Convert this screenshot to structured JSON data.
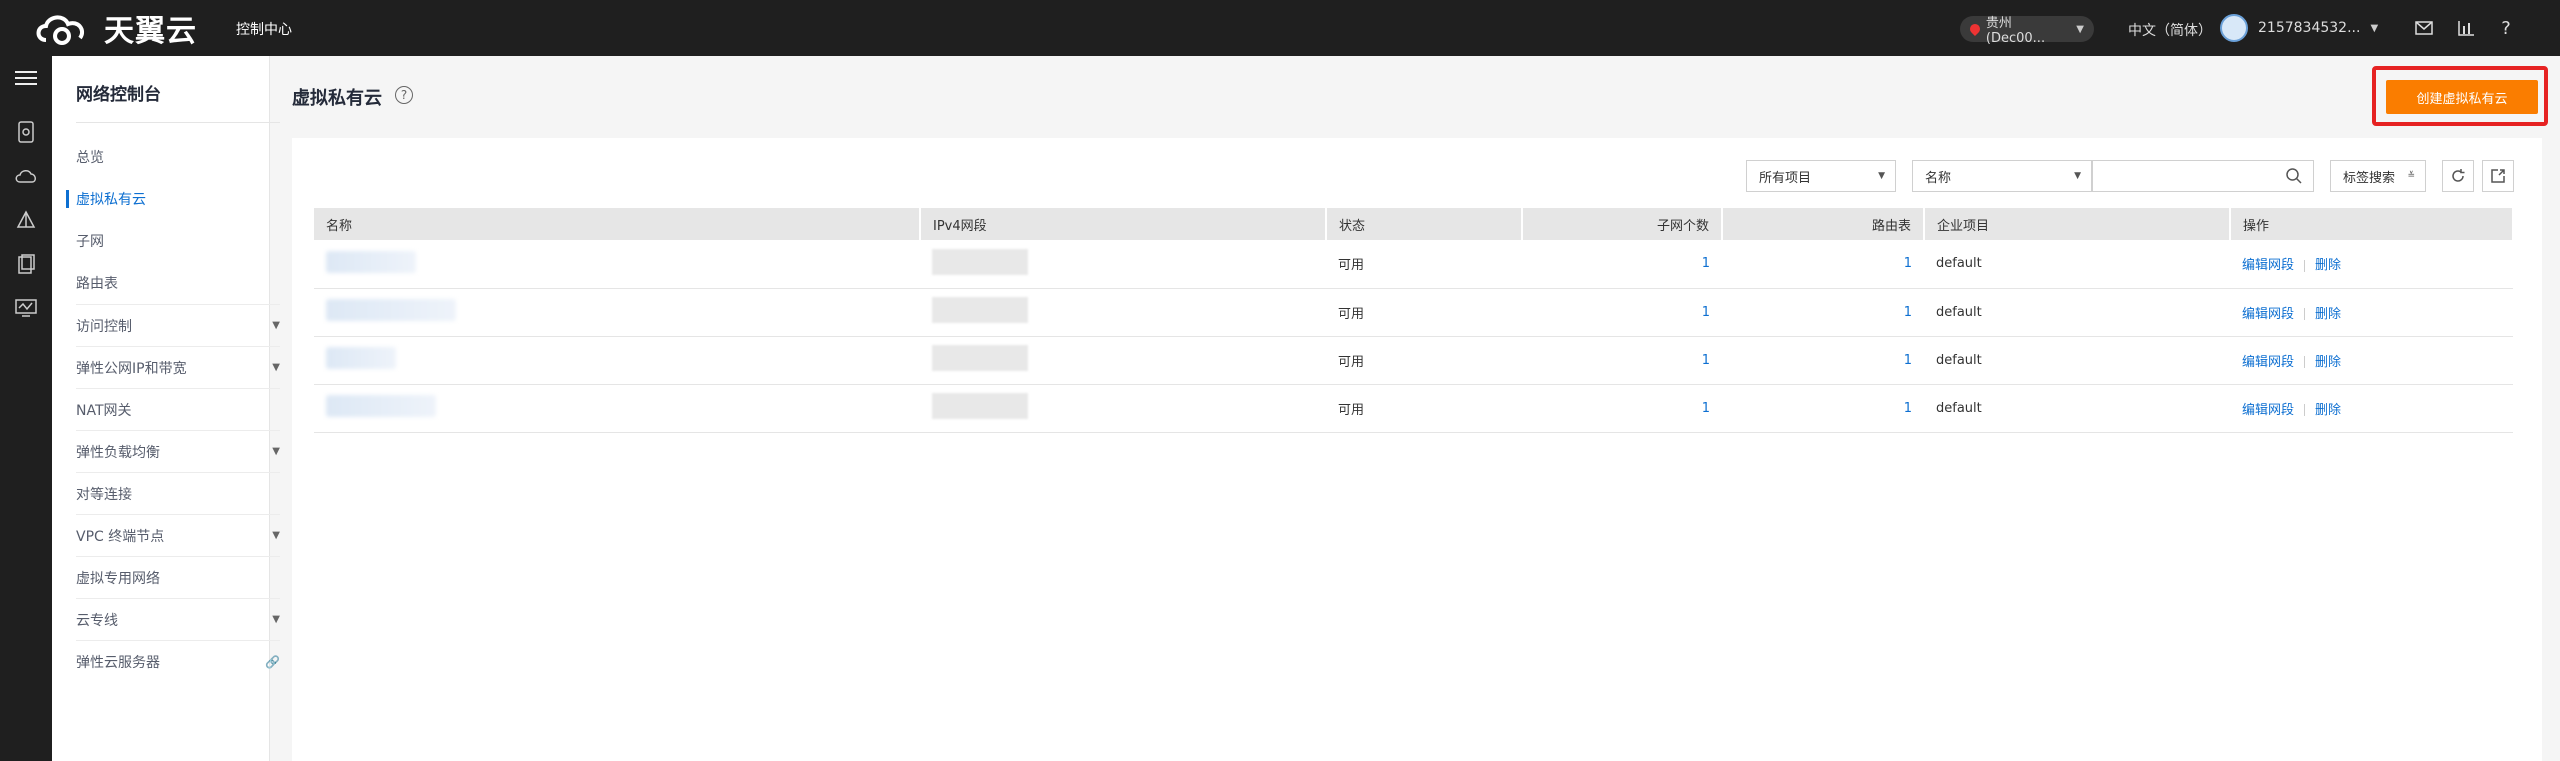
{
  "topbar": {
    "logo_text": "天翼云",
    "console": "控制中心",
    "region": "贵州(Dec00...",
    "language": "中文（简体）",
    "username": "2157834532..."
  },
  "nav": {
    "title": "网络控制台",
    "items": [
      {
        "label": "总览"
      },
      {
        "label": "虚拟私有云"
      },
      {
        "label": "子网"
      },
      {
        "label": "路由表"
      },
      {
        "label": "访问控制"
      },
      {
        "label": "弹性公网IP和带宽"
      },
      {
        "label": "NAT网关"
      },
      {
        "label": "弹性负载均衡"
      },
      {
        "label": "对等连接"
      },
      {
        "label": "VPC 终端节点"
      },
      {
        "label": "虚拟专用网络"
      },
      {
        "label": "云专线"
      },
      {
        "label": "弹性云服务器"
      }
    ]
  },
  "main": {
    "title": "虚拟私有云",
    "create_button": "创建虚拟私有云",
    "filters": {
      "project": "所有项目",
      "field": "名称",
      "search_placeholder": "",
      "tag_search": "标签搜索"
    },
    "table": {
      "headers": [
        "名称",
        "IPv4网段",
        "状态",
        "子网个数",
        "路由表",
        "企业项目",
        "操作"
      ],
      "rows": [
        {
          "status": "可用",
          "subnets": "1",
          "route_tables": "1",
          "project": "default"
        },
        {
          "status": "可用",
          "subnets": "1",
          "route_tables": "1",
          "project": "default"
        },
        {
          "status": "可用",
          "subnets": "1",
          "route_tables": "1",
          "project": "default"
        },
        {
          "status": "可用",
          "subnets": "1",
          "route_tables": "1",
          "project": "default"
        }
      ],
      "op_edit": "编辑网段",
      "op_delete": "删除"
    }
  },
  "colors": {
    "accent": "#0d6fd1",
    "create_button": "#fa7d00",
    "highlight_box": "#e62222",
    "topbar": "#1f1f1f"
  }
}
